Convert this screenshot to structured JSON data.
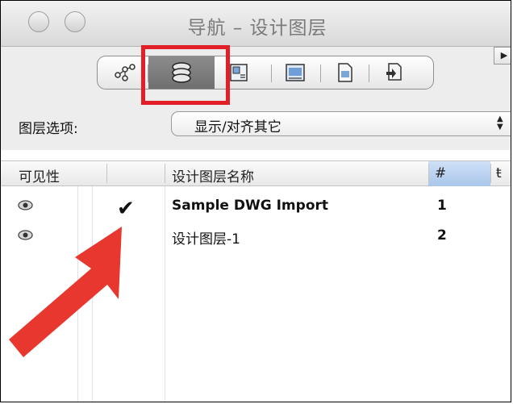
{
  "window": {
    "title": "导航 – 设计图层"
  },
  "toolbar": {
    "items": [
      {
        "icon": "network-icon"
      },
      {
        "icon": "layers-icon",
        "active": true
      },
      {
        "icon": "layout-icon"
      },
      {
        "icon": "sheet-icon"
      },
      {
        "icon": "document-icon"
      },
      {
        "icon": "publish-icon"
      }
    ],
    "right_button": "▶"
  },
  "layer_options": {
    "label": "图层选项:",
    "selected": "显示/对齐其它"
  },
  "table": {
    "columns": [
      "可见性",
      "",
      "设计图层名称",
      "#",
      "ŧ"
    ],
    "rows": [
      {
        "visible": true,
        "active": true,
        "name": "Sample DWG Import",
        "number": "1"
      },
      {
        "visible": true,
        "active": false,
        "name": "设计图层-1",
        "number": "2"
      }
    ]
  },
  "annotation": {
    "highlight_color": "#e21f26",
    "arrow_color": "#e8372f"
  }
}
